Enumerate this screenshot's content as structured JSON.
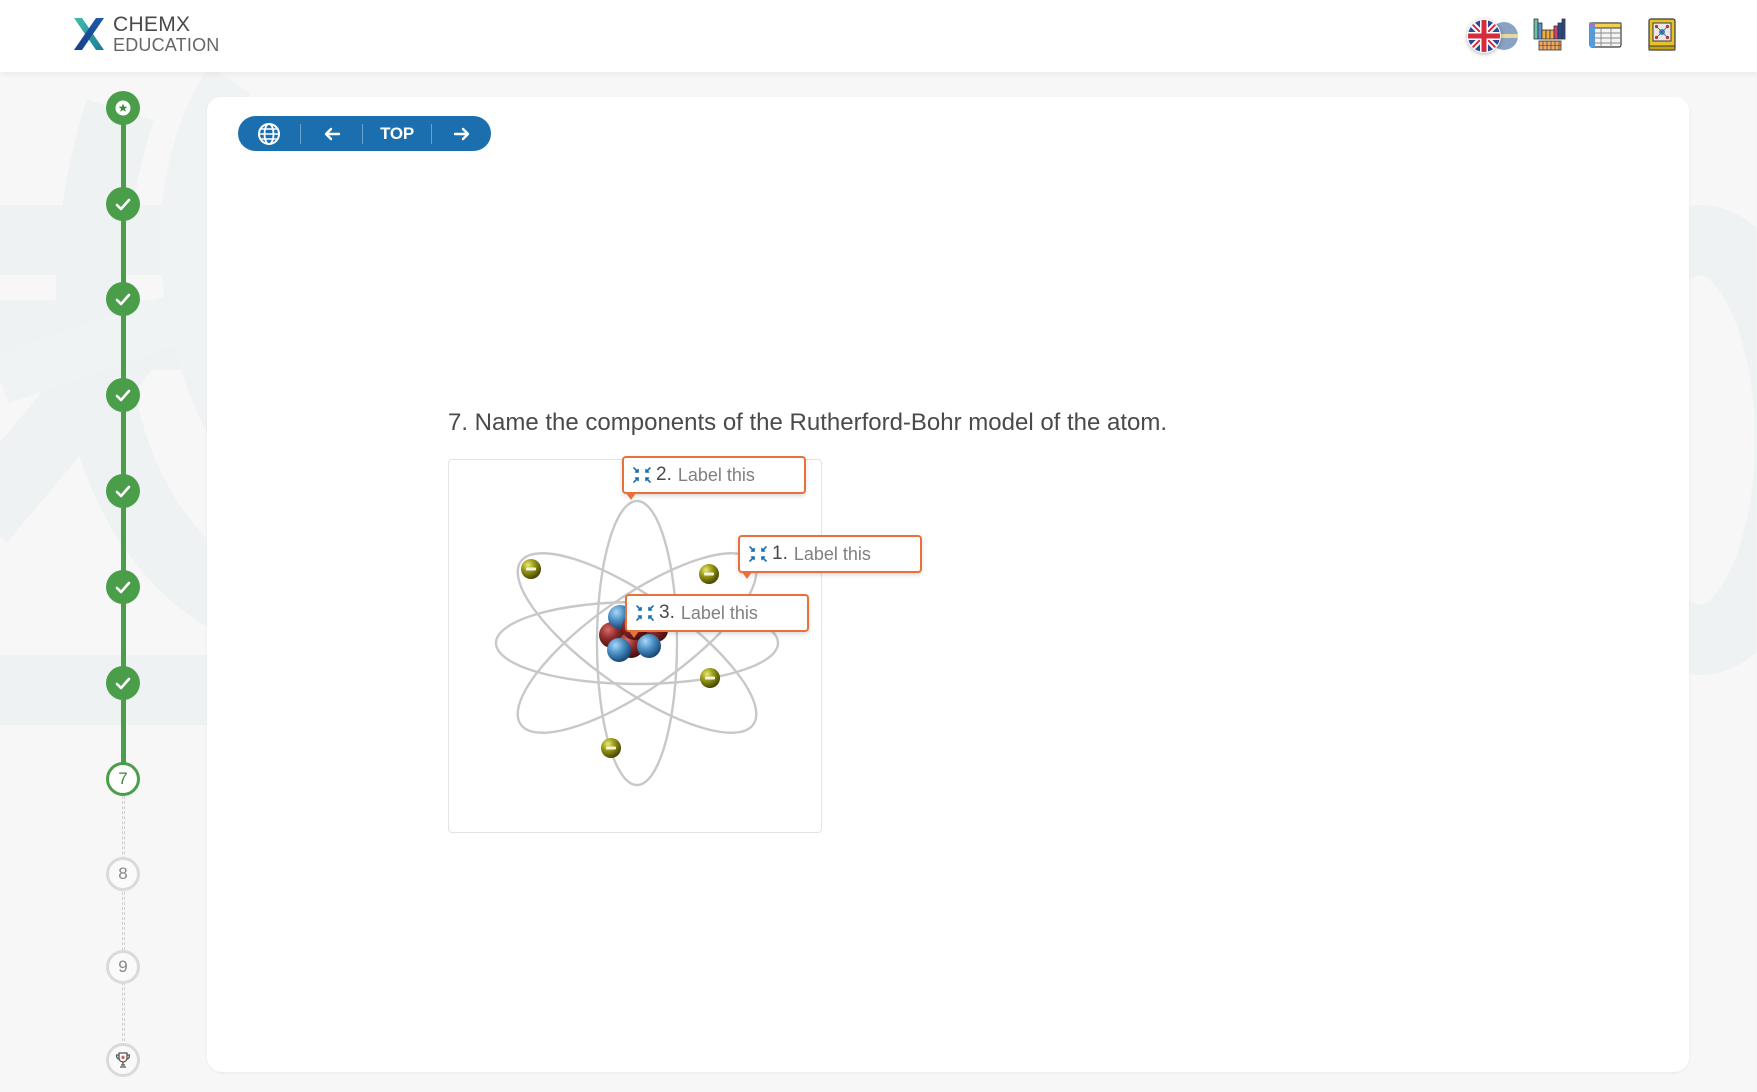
{
  "header": {
    "brand_line1": "CHEMX",
    "brand_line2": "EDUCATION",
    "tools": [
      {
        "name": "language-switcher",
        "icon": "uk-flag-icon",
        "secondary_icon": "swedish-flag-icon"
      },
      {
        "name": "periodic-table",
        "icon": "periodic-table-icon"
      },
      {
        "name": "data-table",
        "icon": "table-icon"
      },
      {
        "name": "handbook",
        "icon": "book-icon"
      }
    ]
  },
  "stepper": {
    "steps": [
      {
        "state": "done",
        "icon": "star-icon",
        "label": ""
      },
      {
        "state": "done",
        "icon": "check-icon",
        "label": ""
      },
      {
        "state": "done",
        "icon": "check-icon",
        "label": ""
      },
      {
        "state": "done",
        "icon": "check-icon",
        "label": ""
      },
      {
        "state": "done",
        "icon": "check-icon",
        "label": ""
      },
      {
        "state": "done",
        "icon": "check-icon",
        "label": ""
      },
      {
        "state": "done",
        "icon": "check-icon",
        "label": ""
      },
      {
        "state": "current",
        "icon": "",
        "label": "7"
      },
      {
        "state": "todo",
        "icon": "",
        "label": "8"
      },
      {
        "state": "todo",
        "icon": "",
        "label": "9"
      },
      {
        "state": "todo",
        "icon": "trophy-icon",
        "label": ""
      }
    ]
  },
  "nav": {
    "globe_icon": "globe-icon",
    "prev_icon": "arrow-left-icon",
    "top_label": "TOP",
    "next_icon": "arrow-right-icon"
  },
  "question": {
    "text": "7. Name the components of the Rutherford-Bohr model of the atom.",
    "labels": [
      {
        "number": "2.",
        "placeholder": "Label this",
        "icon": "collapse-arrows-icon"
      },
      {
        "number": "1.",
        "placeholder": "Label this",
        "icon": "collapse-arrows-icon"
      },
      {
        "number": "3.",
        "placeholder": "Label this",
        "icon": "collapse-arrows-icon"
      }
    ]
  },
  "colors": {
    "accent_blue": "#1c6fae",
    "progress_green": "#4a9e4a",
    "label_border": "#e8703a",
    "electron": "#8a8a10",
    "proton": "#8e2a2a",
    "neutron": "#4a8fc4"
  }
}
